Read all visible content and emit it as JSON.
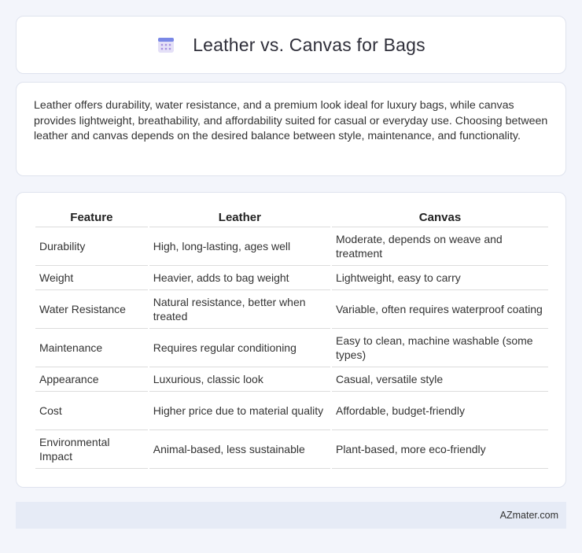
{
  "header": {
    "title": "Leather vs. Canvas for Bags",
    "icon": "calendar-icon"
  },
  "summary": {
    "text": "Leather offers durability, water resistance, and a premium look ideal for luxury bags, while canvas provides lightweight, breathability, and affordability suited for casual or everyday use. Choosing between leather and canvas depends on the desired balance between style, maintenance, and functionality."
  },
  "table": {
    "headers": [
      "Feature",
      "Leather",
      "Canvas"
    ],
    "rows": [
      [
        "Durability",
        "High, long-lasting, ages well",
        "Moderate, depends on weave and treatment"
      ],
      [
        "Weight",
        "Heavier, adds to bag weight",
        "Lightweight, easy to carry"
      ],
      [
        "Water Resistance",
        "Natural resistance, better when treated",
        "Variable, often requires waterproof coating"
      ],
      [
        "Maintenance",
        "Requires regular conditioning",
        "Easy to clean, machine washable (some types)"
      ],
      [
        "Appearance",
        "Luxurious, classic look",
        "Casual, versatile style"
      ],
      [
        "Cost",
        "Higher price due to material quality",
        "Affordable, budget-friendly"
      ],
      [
        "Environmental Impact",
        "Animal-based, less sustainable",
        "Plant-based, more eco-friendly"
      ]
    ]
  },
  "footer": {
    "text": "AZmater.com"
  }
}
